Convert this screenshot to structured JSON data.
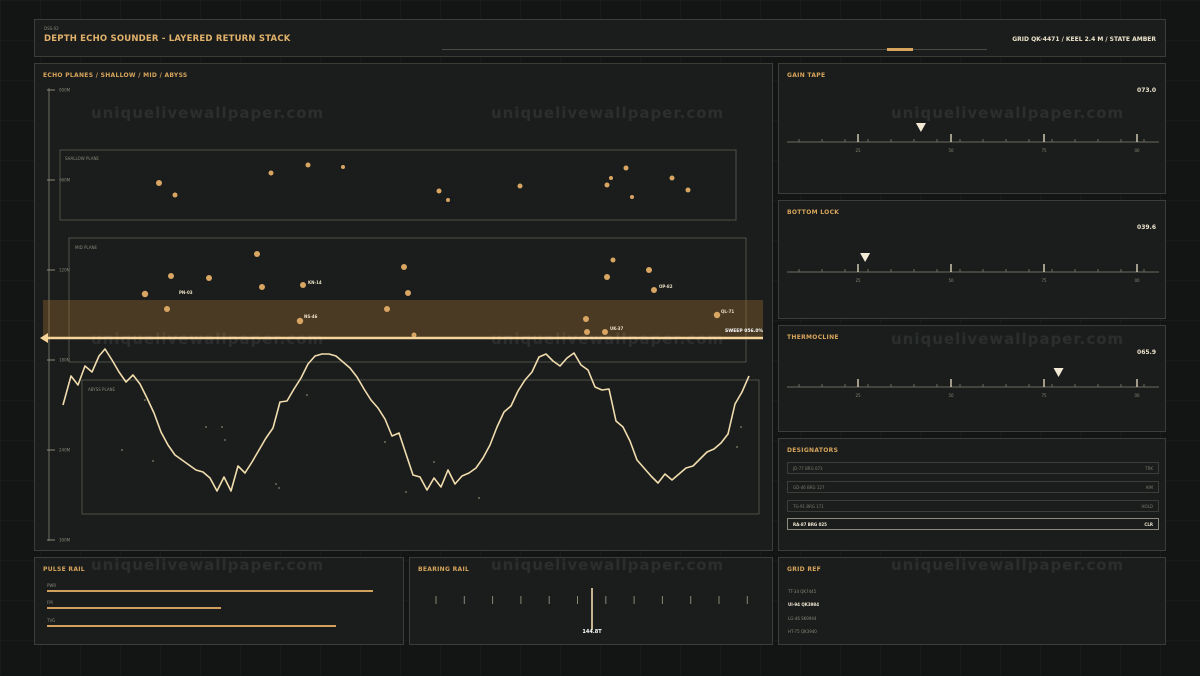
{
  "header": {
    "code": "DSS-02",
    "title": "DEPTH ECHO SOUNDER - LAYERED RETURN STACK",
    "status": "GRID QK-4471 / KEEL 2.4 M / STATE AMBER"
  },
  "watermark": "uniquelivewallpaper.com",
  "main": {
    "title": "ECHO PLANES / SHALLOW / MID / ABYSS",
    "depth_ticks": [
      "000M",
      "060M",
      "120M",
      "180M",
      "240M",
      "300M"
    ],
    "plane_labels": [
      "SHALLOW PLANE",
      "MID PLANE",
      "ABYSS PLANE"
    ],
    "contacts": [
      "PN-03",
      "KN-14",
      "NS-46",
      "OP-82",
      "UK-37",
      "QL-71"
    ],
    "sweep_label": "SWEEP 056.0%"
  },
  "gain": {
    "title": "GAIN TAPE",
    "value": "073.0",
    "ticks": [
      "25",
      "50",
      "75",
      "00"
    ],
    "pointer": 0.36
  },
  "bottom": {
    "title": "BOTTOM LOCK",
    "value": "039.6",
    "ticks": [
      "25",
      "50",
      "75",
      "00"
    ],
    "pointer": 0.21
  },
  "thermo": {
    "title": "THERMOCLINE",
    "value": "065.9",
    "ticks": [
      "25",
      "50",
      "75",
      "00"
    ],
    "pointer": 0.73
  },
  "designators": {
    "title": "DESIGNATORS",
    "rows": [
      {
        "id": "JD-77 BRG 073",
        "state": "TRK",
        "active": false
      },
      {
        "id": "GD-46 BRG 127",
        "state": "AIM",
        "active": false
      },
      {
        "id": "TG-91 BRG 171",
        "state": "HOLD",
        "active": false
      },
      {
        "id": "RA-87 BRG 025",
        "state": "CLR",
        "active": true
      }
    ]
  },
  "pulse": {
    "title": "PULSE RAIL",
    "rows": [
      {
        "label": "PWR",
        "value": 0.88
      },
      {
        "label": "FM",
        "value": 0.47
      },
      {
        "label": "TVG",
        "value": 0.78
      }
    ]
  },
  "bearing": {
    "title": "BEARING RAIL",
    "value": "144.8T"
  },
  "gridref": {
    "title": "GRID REF",
    "rows": [
      {
        "text": "TT-34 QK7445",
        "active": false
      },
      {
        "text": "UI-94 QK3984",
        "active": true
      },
      {
        "text": "LG-46 SK9944",
        "active": false
      },
      {
        "text": "HT-75 QK3940",
        "active": false
      }
    ]
  },
  "colors": {
    "accent": "#d8a55c",
    "wave": "#f1dcae",
    "sweep": "#e7c68c",
    "panel": "#1a1d1c",
    "border": "#3b3e38"
  }
}
